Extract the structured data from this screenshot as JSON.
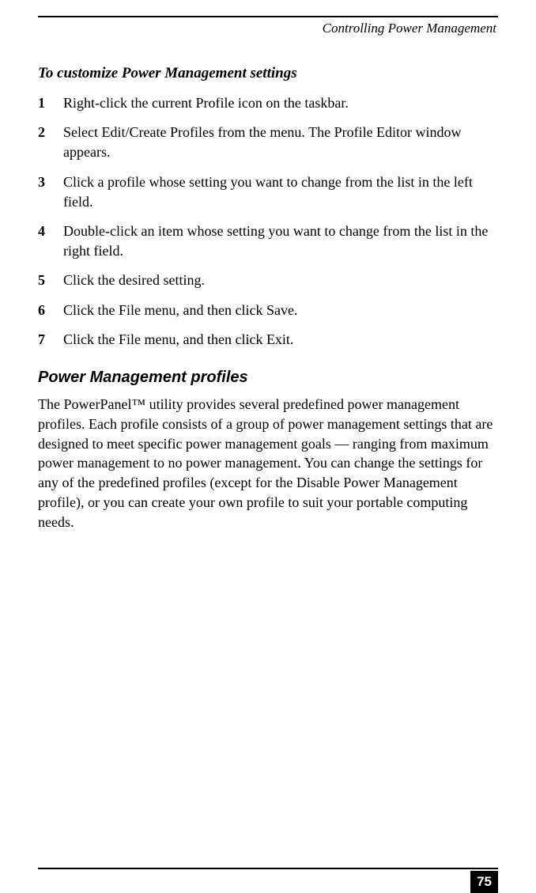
{
  "header": {
    "chapter": "Controlling Power Management"
  },
  "section": {
    "title": "To customize Power Management settings",
    "steps": [
      {
        "num": "1",
        "text": "Right-click the current Profile icon on the taskbar."
      },
      {
        "num": "2",
        "text": "Select Edit/Create Profiles from the menu. The Profile Editor window appears."
      },
      {
        "num": "3",
        "text": "Click a profile whose setting you want to change from the list in the left field."
      },
      {
        "num": "4",
        "text": "Double-click an item whose setting you want to change from the list in the right field."
      },
      {
        "num": "5",
        "text": "Click the desired setting."
      },
      {
        "num": "6",
        "text": "Click the File menu, and then click Save."
      },
      {
        "num": "7",
        "text": "Click the File menu, and then click Exit."
      }
    ]
  },
  "subsection": {
    "title": "Power Management profiles",
    "paragraph": "The PowerPanel™ utility provides several predefined power management profiles. Each profile consists of a group of power management settings that are designed to meet specific power management goals — ranging from maximum power management to no power management. You can change the settings for any of the predefined profiles (except for the Disable Power Management profile), or you can create your own profile to suit your portable computing needs."
  },
  "footer": {
    "page_number": "75"
  }
}
